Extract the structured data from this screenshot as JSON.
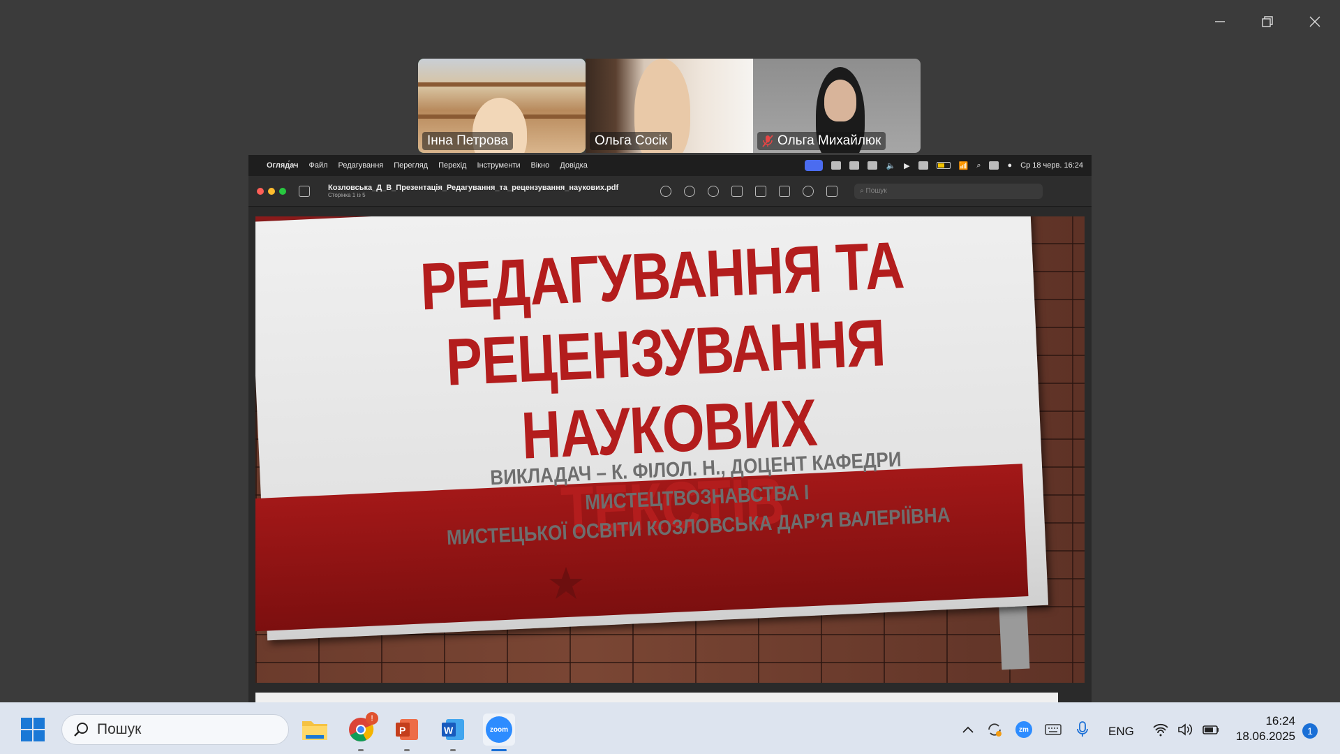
{
  "window": {
    "controls": [
      "minimize-icon",
      "maximize-icon",
      "close-icon"
    ]
  },
  "participants": [
    {
      "name": "Інна Петрова",
      "active": true,
      "muted": false
    },
    {
      "name": "Ольга Сосік",
      "active": false,
      "muted": false
    },
    {
      "name": "Ольга Михайлюк",
      "active": false,
      "muted": true
    }
  ],
  "mac_menubar": {
    "items": [
      "Огляд́ач",
      "Файл",
      "Редагування",
      "Перегляд",
      "Перехід",
      "Інструменти",
      "Вікно",
      "Довідка"
    ],
    "datetime": "Ср 18 черв. 16:24"
  },
  "preview": {
    "file_title": "Козловська_Д_В_Презентація_Редагування_та_рецензування_наукових.pdf",
    "page_info": "Сторінка 1 із 5",
    "search_placeholder": "Пошук"
  },
  "slide": {
    "title_lines": [
      "РЕДАГУВАННЯ ТА",
      "РЕЦЕНЗУВАННЯ",
      "НАУКОВИХ ТЕКСТІВ"
    ],
    "subtitle_lines": [
      "ВИКЛАДАЧ – К. ФІЛОЛ. Н., ДОЦЕНТ КАФЕДРИ МИСТЕЦТВОЗНАВСТВА І",
      "МИСТЕЦЬКОЇ ОСВІТИ КОЗЛОВСЬКА ДАР’Я ВАЛЕРІЇВНА"
    ]
  },
  "taskbar": {
    "search_placeholder": "Пошук",
    "chrome_badge": "!",
    "zoom_label": "zoom",
    "language": "ENG",
    "time": "16:24",
    "date": "18.06.2025",
    "notification_count": "1"
  },
  "colors": {
    "accent_green": "#2bd36b",
    "slide_red": "#b31d1d",
    "taskbar_blue": "#1a6fd6"
  }
}
